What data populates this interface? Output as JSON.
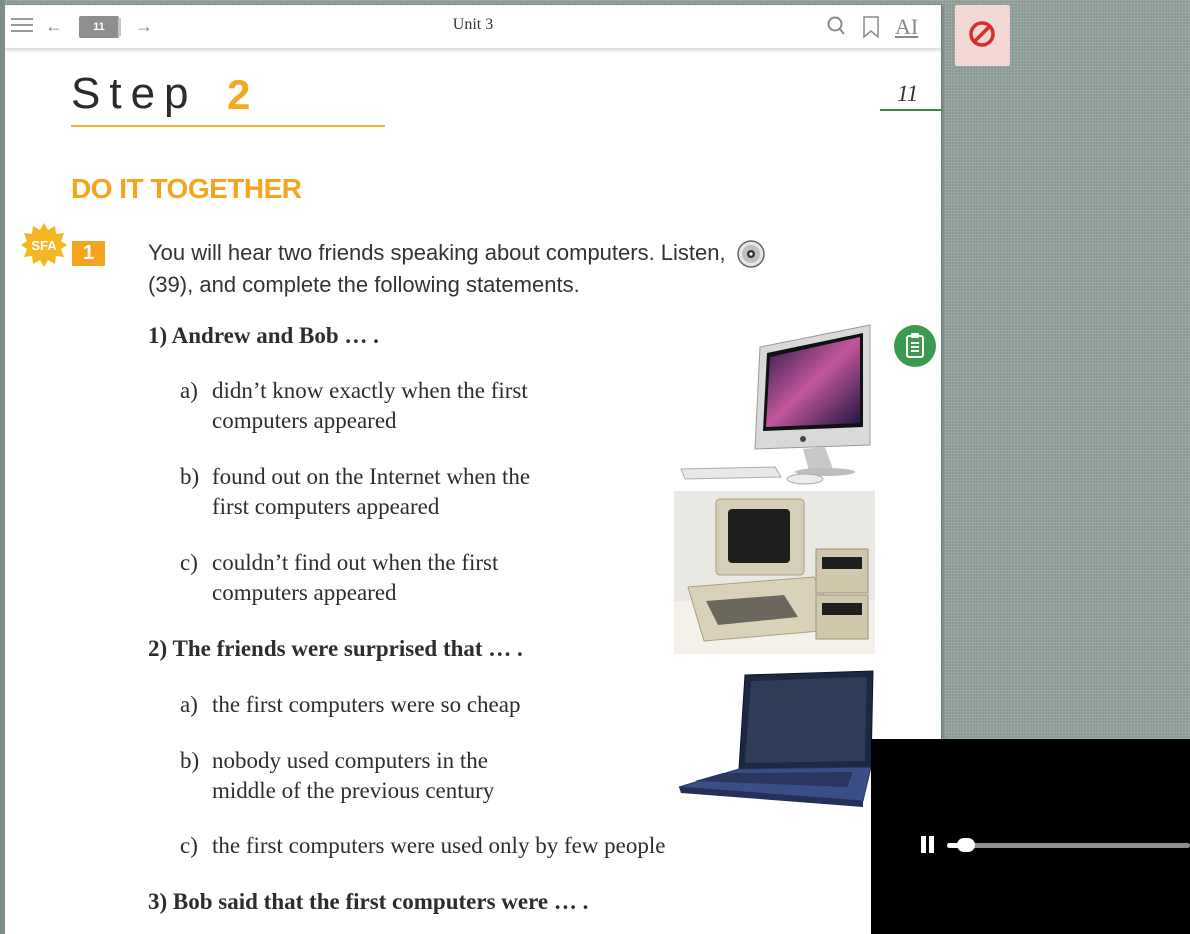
{
  "toolbar": {
    "current_page": "11",
    "title": "Unit 3"
  },
  "page": {
    "step_word": "Step",
    "step_number": "2",
    "page_number": "11",
    "section_heading": "DO IT TOGETHER",
    "task": {
      "badge": "SFA",
      "number": "1",
      "instruction_part1": "You will hear two friends speaking about computers. Listen,",
      "instruction_part2": "(39), and complete the following statements."
    },
    "questions": [
      {
        "head": "1) Andrew and Bob … .",
        "options": [
          {
            "letter": "a)",
            "line1": "didn’t know exactly when the first",
            "line2": "computers appeared"
          },
          {
            "letter": "b)",
            "line1": "found out on the Internet when the",
            "line2": "first computers appeared"
          },
          {
            "letter": "c)",
            "line1": "couldn’t find out when the first",
            "line2": "computers appeared"
          }
        ]
      },
      {
        "head": "2) The friends were surprised that … .",
        "options": [
          {
            "letter": "a)",
            "line1": "the first computers were so cheap",
            "line2": ""
          },
          {
            "letter": "b)",
            "line1": "nobody used computers in the",
            "line2": "middle of the previous century"
          },
          {
            "letter": "c)",
            "line1": "the first computers were used only by few people",
            "line2": ""
          }
        ]
      },
      {
        "head": "3) Bob said that the first computers were … ."
      }
    ]
  },
  "icons": {
    "menu": "hamburger-icon",
    "back": "arrow-left-icon",
    "forward": "arrow-right-icon",
    "search": "search-icon",
    "bookmark": "bookmark-icon",
    "font_size": "font-size-icon",
    "audio": "cd-icon",
    "clipboard": "clipboard-icon",
    "blocked": "ban-icon",
    "play_state": "pause-icon"
  },
  "media_player": {
    "progress": 0.08
  },
  "colors": {
    "accent_orange": "#f5a41d",
    "green": "#3b9a4d",
    "ban_red": "#d4302c",
    "backdrop": "#95a59f"
  }
}
